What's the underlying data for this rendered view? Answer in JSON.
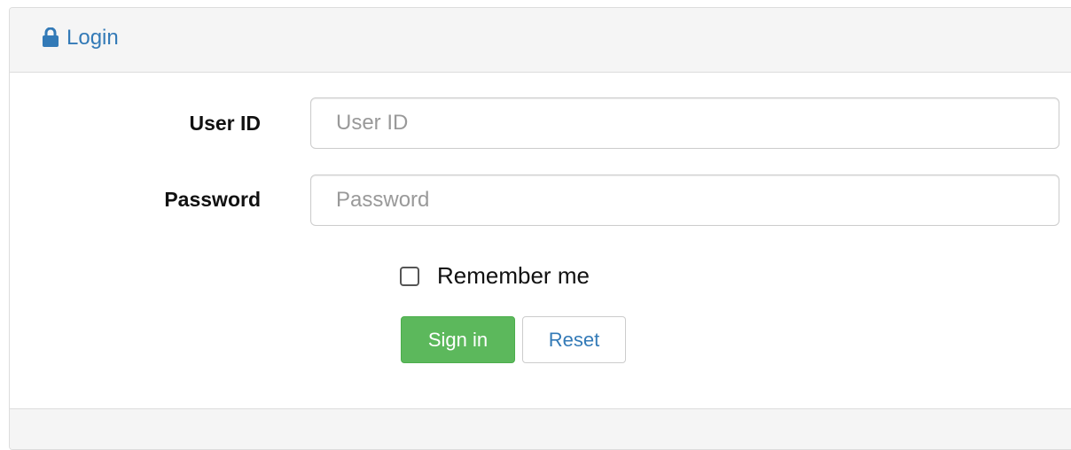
{
  "panel": {
    "heading": {
      "icon": "lock-icon",
      "title": "Login",
      "title_color": "#337ab7"
    }
  },
  "form": {
    "user_id": {
      "label": "User ID",
      "placeholder": "User ID",
      "value": ""
    },
    "password": {
      "label": "Password",
      "placeholder": "Password",
      "value": ""
    },
    "remember": {
      "label": "Remember me",
      "checked": false
    },
    "buttons": {
      "signin_label": "Sign in",
      "reset_label": "Reset"
    }
  },
  "colors": {
    "primary_link": "#337ab7",
    "success_button": "#5cb85c",
    "panel_heading_bg": "#f5f5f5",
    "border": "#dddddd"
  }
}
